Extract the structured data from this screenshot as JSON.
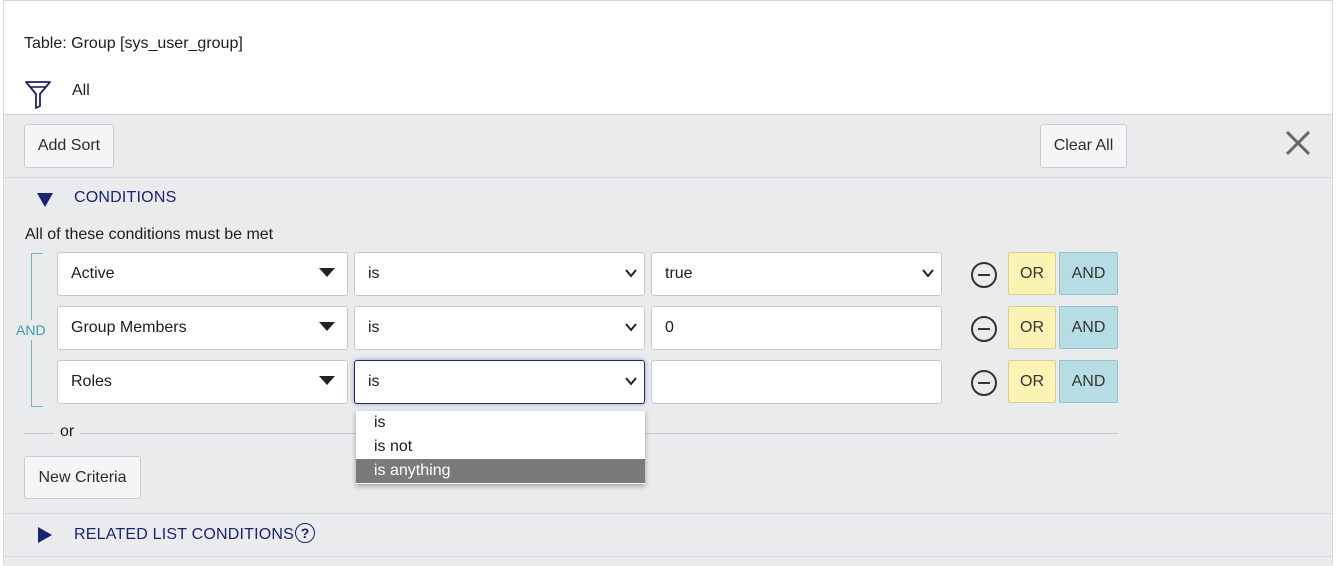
{
  "header": {
    "table_title": "Table: Group [sys_user_group]",
    "filter_breadcrumb": "All"
  },
  "toolbar": {
    "add_sort_label": "Add Sort",
    "clear_all_label": "Clear All"
  },
  "conditions": {
    "section_title": "CONDITIONS",
    "note": "All of these conditions must be met",
    "group_operator": "AND",
    "rows": [
      {
        "field": "Active",
        "operator": "is",
        "value": "true",
        "or_label": "OR",
        "and_label": "AND"
      },
      {
        "field": "Group Members",
        "operator": "is",
        "value": "0",
        "or_label": "OR",
        "and_label": "AND"
      },
      {
        "field": "Roles",
        "operator": "is",
        "value": "",
        "or_label": "OR",
        "and_label": "AND"
      }
    ],
    "or_separator": "or",
    "new_criteria_label": "New Criteria"
  },
  "operator_dropdown": {
    "options": [
      "is",
      "is not",
      "is anything"
    ],
    "highlighted": "is anything"
  },
  "related_list": {
    "section_title": "RELATED LIST CONDITIONS",
    "help_symbol": "?"
  },
  "colors": {
    "accent_navy": "#1a2273",
    "or_yellow": "#fbf3b4",
    "and_teal": "#b6dde4",
    "panel_gray": "#e9ebed"
  }
}
